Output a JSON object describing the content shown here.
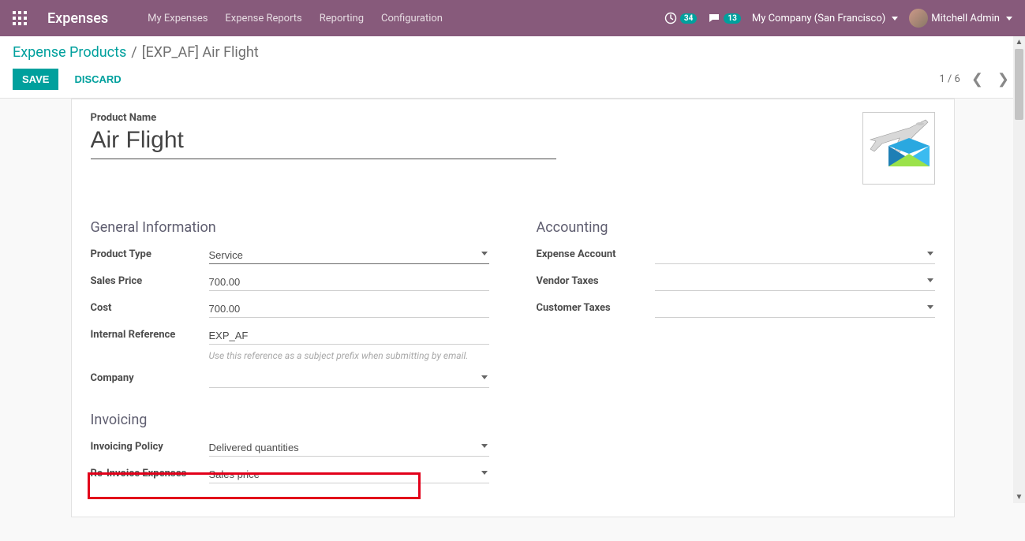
{
  "topbar": {
    "brand": "Expenses",
    "nav": [
      "My Expenses",
      "Expense Reports",
      "Reporting",
      "Configuration"
    ],
    "activity_count": "34",
    "discuss_count": "13",
    "company": "My Company (San Francisco)",
    "user": "Mitchell Admin"
  },
  "breadcrumb": {
    "parent": "Expense Products",
    "current": "[EXP_AF] Air Flight"
  },
  "actions": {
    "save": "SAVE",
    "discard": "DISCARD"
  },
  "pager": {
    "text": "1 / 6"
  },
  "form": {
    "product_name_label": "Product Name",
    "product_name": "Air Flight",
    "sections": {
      "general": "General Information",
      "accounting": "Accounting",
      "invoicing": "Invoicing"
    },
    "labels": {
      "product_type": "Product Type",
      "sales_price": "Sales Price",
      "cost": "Cost",
      "internal_reference": "Internal Reference",
      "company": "Company",
      "expense_account": "Expense Account",
      "vendor_taxes": "Vendor Taxes",
      "customer_taxes": "Customer Taxes",
      "invoicing_policy": "Invoicing Policy",
      "reinvoice": "Re-Invoice Expenses"
    },
    "values": {
      "product_type": "Service",
      "sales_price": "700.00",
      "cost": "700.00",
      "internal_reference": "EXP_AF",
      "company": "",
      "expense_account": "",
      "vendor_taxes": "",
      "customer_taxes": "",
      "invoicing_policy": "Delivered quantities",
      "reinvoice": "Sales price"
    },
    "help": {
      "internal_reference": "Use this reference as a subject prefix when submitting by email."
    }
  }
}
